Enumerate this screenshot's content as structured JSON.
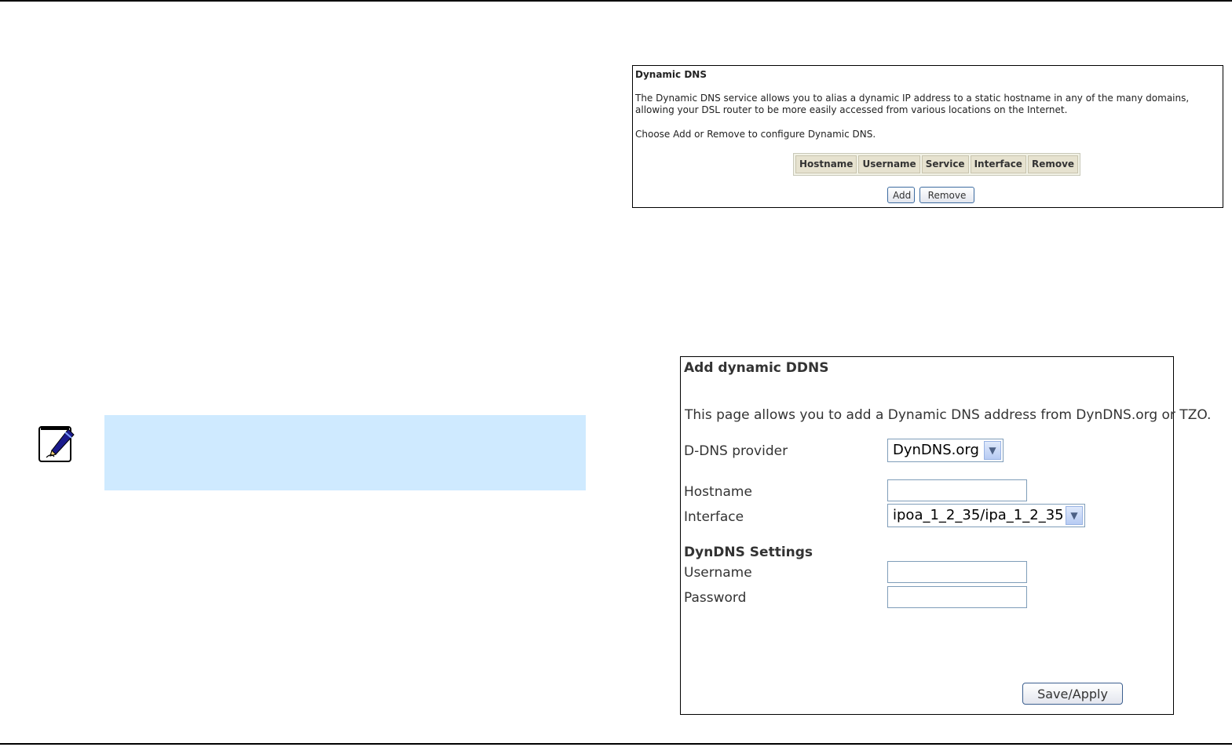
{
  "ddns_list": {
    "title": "Dynamic DNS",
    "description": "The Dynamic DNS service allows you to alias a dynamic IP address to a static hostname in any of the many domains, allowing your DSL router to be more easily accessed from various locations on the Internet.",
    "instruction": "Choose Add or Remove to configure Dynamic DNS.",
    "columns": [
      "Hostname",
      "Username",
      "Service",
      "Interface",
      "Remove"
    ],
    "add_label": "Add",
    "remove_label": "Remove"
  },
  "add_ddns": {
    "title": "Add dynamic DDNS",
    "description": "This page allows you to add a Dynamic DNS address from DynDNS.org or TZO.",
    "provider_label": "D-DNS provider",
    "provider_value": "DynDNS.org",
    "hostname_label": "Hostname",
    "hostname_value": "",
    "interface_label": "Interface",
    "interface_value": "ipoa_1_2_35/ipa_1_2_35",
    "settings_heading": "DynDNS Settings",
    "username_label": "Username",
    "username_value": "",
    "password_label": "Password",
    "password_value": "",
    "save_label": "Save/Apply"
  },
  "icons": {
    "note": "note-pencil-icon",
    "dropdown": "chevron-down-icon"
  },
  "colors": {
    "note_background": "#cfeaff",
    "table_header": "#e6e2cf"
  }
}
